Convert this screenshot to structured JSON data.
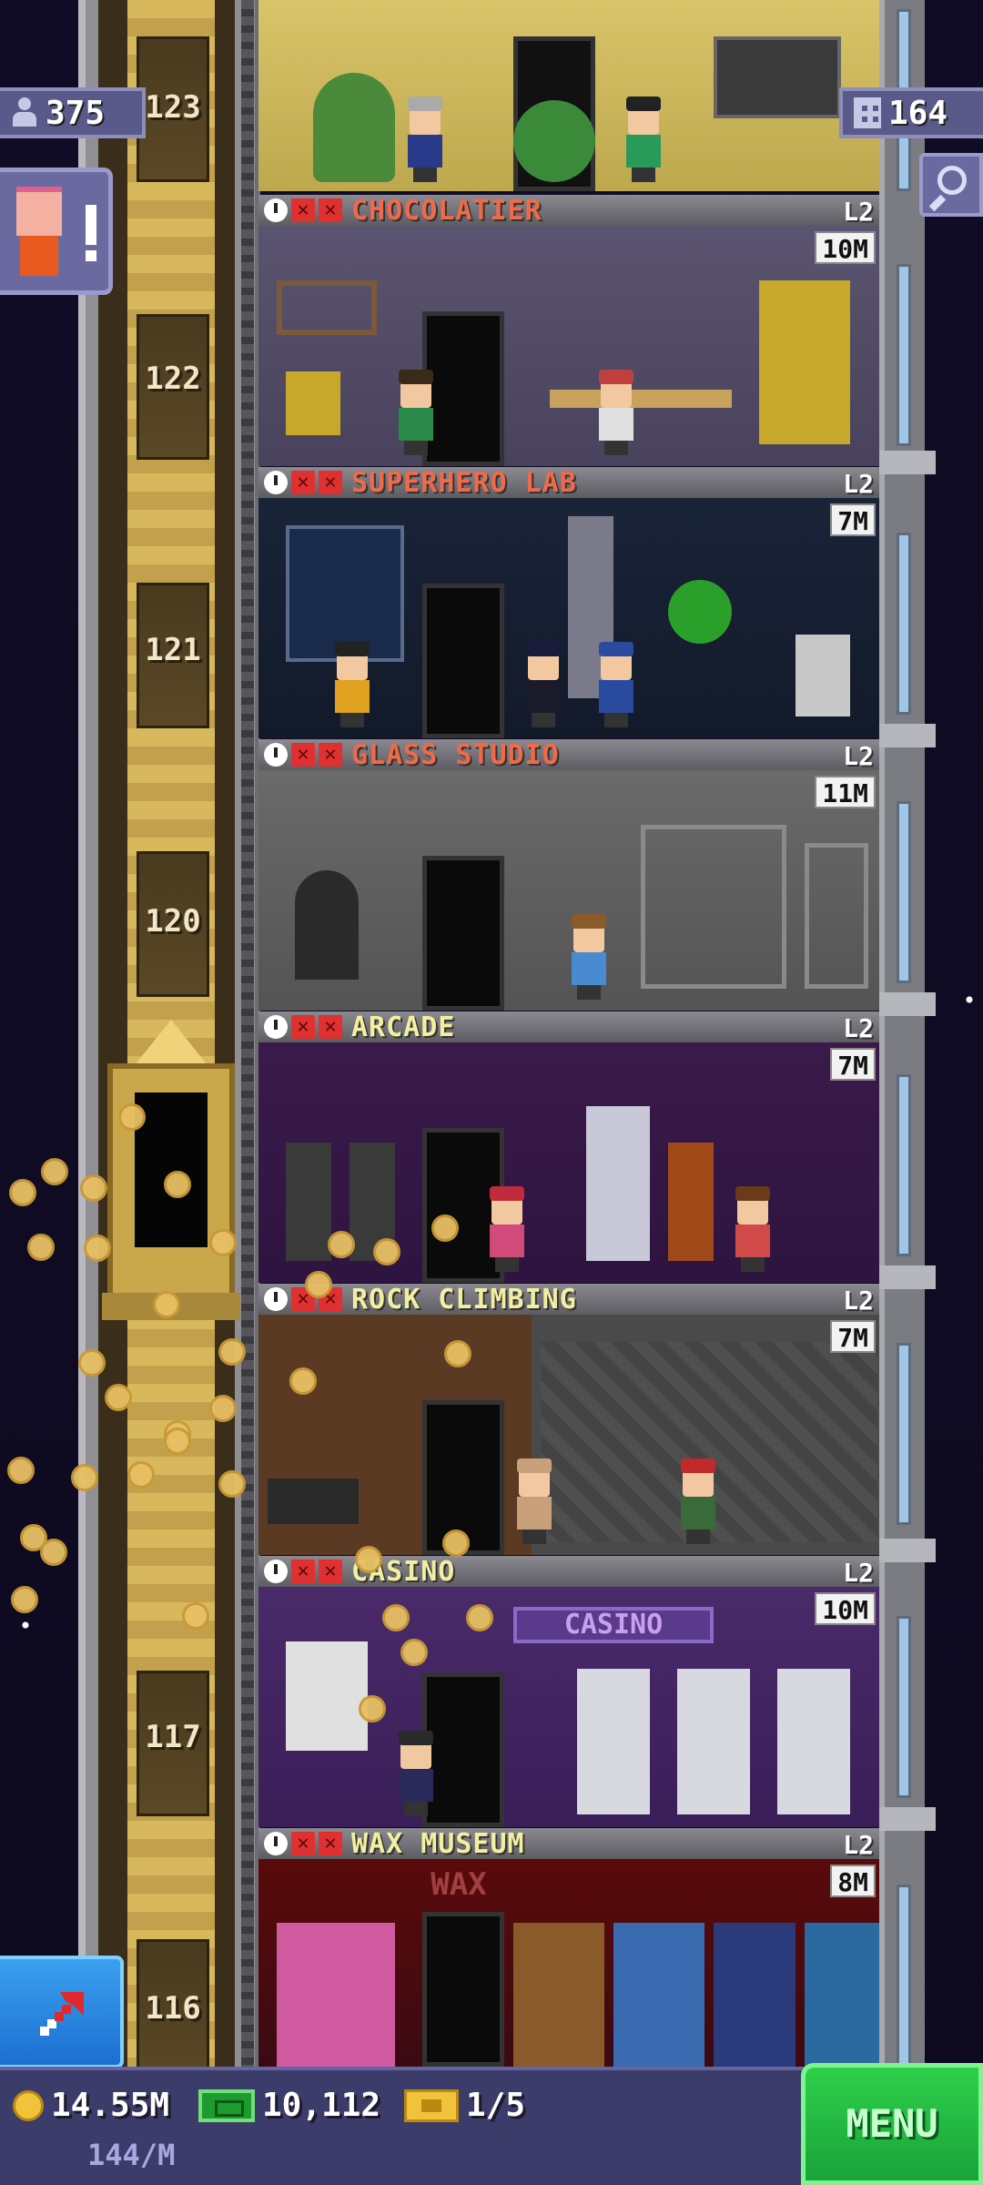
{
  "hud": {
    "citizens": "375",
    "floors": "164"
  },
  "shaft_floor_numbers": [
    "123",
    "122",
    "121",
    "120",
    "117",
    "116"
  ],
  "floors": [
    {
      "name": "CHOCOLATIER",
      "level": "L2",
      "earnings": "10M",
      "name_color": "#f06a4a"
    },
    {
      "name": "SUPERHERO LAB",
      "level": "L2",
      "earnings": "7M",
      "name_color": "#f06a4a"
    },
    {
      "name": "GLASS STUDIO",
      "level": "L2",
      "earnings": "11M",
      "name_color": "#f06a4a"
    },
    {
      "name": "ARCADE",
      "level": "L2",
      "earnings": "7M",
      "name_color": "#f2f0a0"
    },
    {
      "name": "ROCK CLIMBING",
      "level": "L2",
      "earnings": "7M",
      "name_color": "#f2f0a0"
    },
    {
      "name": "CASINO",
      "level": "L2",
      "earnings": "10M",
      "name_color": "#f2f0a0"
    },
    {
      "name": "WAX MUSEUM",
      "level": "L2",
      "earnings": "8M",
      "name_color": "#f2f0a0"
    }
  ],
  "room_signs": {
    "casino": "CASINO",
    "wax": "WAX"
  },
  "bottom": {
    "coins": "14.55M",
    "coin_rate": "144/M",
    "bux": "10,112",
    "tickets": "1/5",
    "menu_label": "MENU"
  },
  "icons": {
    "citizens": "citizen-icon",
    "floors": "building-icon",
    "search": "magnifier-icon",
    "visitor": "vip-visitor-icon",
    "rocket": "rocket-arrow-icon",
    "coin": "coin-icon",
    "bux": "bux-icon",
    "ticket": "ticket-icon"
  },
  "colors": {
    "menu_green": "#1aa33a",
    "hud_purple": "#5a5a8a",
    "stopped_red": "#e03030"
  }
}
